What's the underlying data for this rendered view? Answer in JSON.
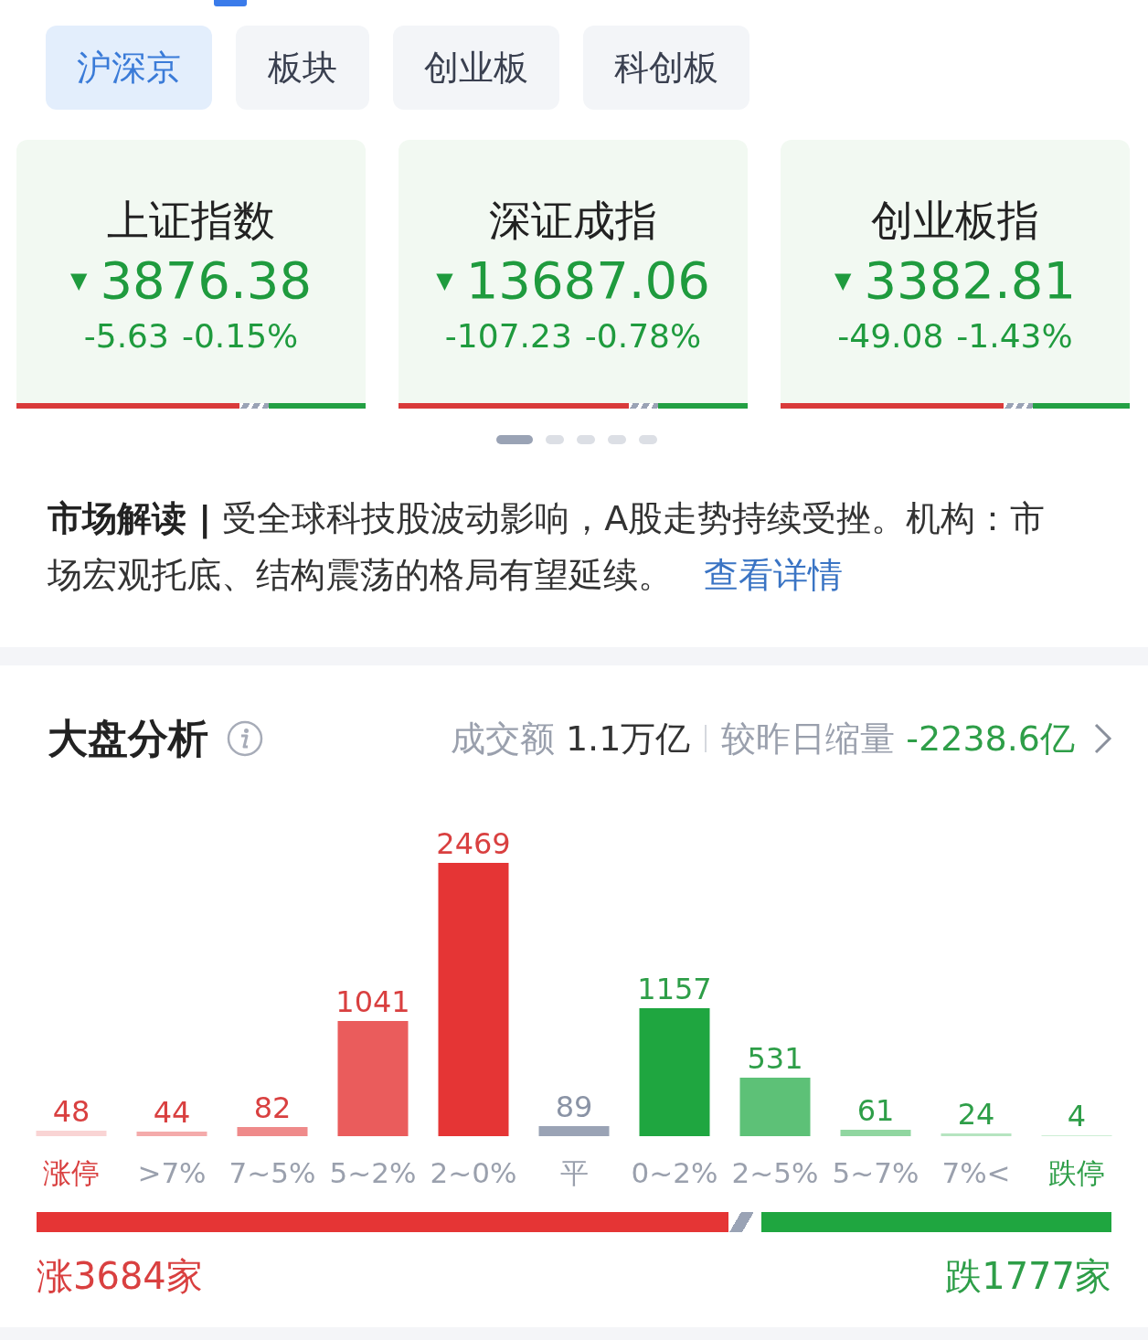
{
  "tabs": [
    {
      "label": "沪深京",
      "selected": true
    },
    {
      "label": "板块",
      "selected": false
    },
    {
      "label": "创业板",
      "selected": false
    },
    {
      "label": "科创板",
      "selected": false
    }
  ],
  "index_cards": [
    {
      "name": "上证指数",
      "arrow": "▼",
      "value": "3876.38",
      "change": "-5.63",
      "percent": "-0.15%",
      "level": 0.64
    },
    {
      "name": "深证成指",
      "arrow": "▼",
      "value": "13687.06",
      "change": "-107.23",
      "percent": "-0.78%",
      "level": 0.66
    },
    {
      "name": "创业板指",
      "arrow": "▼",
      "value": "3382.81",
      "change": "-49.08",
      "percent": "-1.43%",
      "level": 0.64
    }
  ],
  "pager": [
    {
      "selected": true
    },
    {
      "selected": false
    },
    {
      "selected": false
    },
    {
      "selected": false
    },
    {
      "selected": false
    }
  ],
  "market_note": {
    "text": "**市场解读 |** 受全球科技股波动影响，A股走势持续受挫。机构：市场宏观托底、结构震荡的格局有望延续。",
    "link": "查看详情"
  },
  "analysis": {
    "title": "大盘分析",
    "turnover_label": "成交额",
    "turnover": "1.1万亿",
    "compare_label": "较昨日缩量",
    "compare": "-2238.6亿",
    "chart_data": {
      "type": "bar",
      "categories": [
        "涨停",
        ">7%",
        "7~5%",
        "5~2%",
        "2~0%",
        "平",
        "0~2%",
        "2~5%",
        "5~7%",
        "7%<",
        "跌停"
      ],
      "series": [
        {
          "values": [
            48,
            44,
            82,
            1041,
            2469,
            89,
            1157,
            531,
            61,
            24,
            4
          ]
        }
      ],
      "data_labels": true
    },
    "bar_styles": [
      {
        "kind": "limit_up",
        "color": "#f9d4d4"
      },
      {
        "kind": "up",
        "color": "#f4abab"
      },
      {
        "kind": "up",
        "color": "#ef8a8a"
      },
      {
        "kind": "up",
        "color": "#ea5c5c"
      },
      {
        "kind": "up",
        "color": "#e53535"
      },
      {
        "kind": "flat",
        "color": "#9aa3b5"
      },
      {
        "kind": "down",
        "color": "#1fa640"
      },
      {
        "kind": "down",
        "color": "#5dc177"
      },
      {
        "kind": "down",
        "color": "#90d6a0"
      },
      {
        "kind": "down",
        "color": "#b6e4c0"
      },
      {
        "kind": "limit_down",
        "color": "#cdeed4"
      }
    ],
    "breadth": {
      "level": 0.664,
      "up_label": "涨3684家",
      "down_label": "跌1777家"
    }
  }
}
